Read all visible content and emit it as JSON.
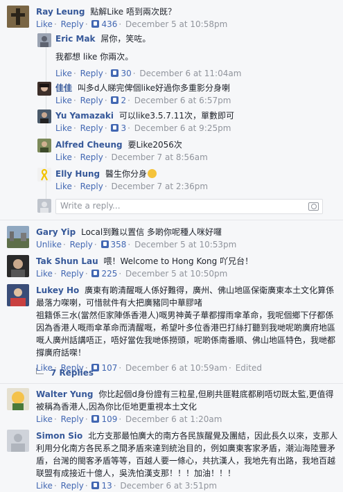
{
  "labels": {
    "like": "Like",
    "unlike": "Unlike",
    "reply": "Reply",
    "edited": "Edited",
    "sep": "·"
  },
  "comments": [
    {
      "name": "Ray Leung",
      "text": "點解Like 唔到兩次既？",
      "like_label": "Like",
      "likes": "436",
      "date": "December 5 at 10:58pm"
    },
    {
      "name": "Eric Mak",
      "text": "屌你，笑咗。",
      "text2": "我都想 like 你兩次。",
      "like_label": "Like",
      "likes": "30",
      "date": "December 6 at 11:04am"
    },
    {
      "name": "佳佳",
      "text": "叫多d人睇完俾個like好過你多重影分身喇",
      "like_label": "Like",
      "likes": "2",
      "date": "December 6 at 6:57pm"
    },
    {
      "name": "Yu Yamazaki",
      "text": "可以like3.5.7.11次，單數即可",
      "like_label": "Like",
      "likes": "3",
      "date": "December 6 at 9:25pm"
    },
    {
      "name": "Alfred Cheung",
      "text": "要Like2056次",
      "like_label": "Like",
      "date": "December 7 at 8:56am"
    },
    {
      "name": "Elly Hung",
      "text": "醫生你分身",
      "like_label": "Like",
      "date": "December 7 at 2:36pm"
    },
    {
      "name": "Gary Yip",
      "text": "Local到難以置信 多啲你呢種人咪好囉",
      "like_label": "Unlike",
      "likes": "358",
      "date": "December 5 at 10:53pm"
    },
    {
      "name": "Tak Shun Lau",
      "text": "喂！Welcome to Hong Kong 吖兄台！",
      "like_label": "Like",
      "likes": "225",
      "date": "December 5 at 10:50pm"
    },
    {
      "name": "Lukey Ho",
      "text": "廣東有啲清醒嘅人係好難得，廣州、佛山地區保衛廣東本土文化算係最落力㗎喇，可惜就件有大把廣豬同中華膠啫",
      "text2": "祖籍係三水(當然佢家陣係香港人)嘅男神黃子華都撐雨傘革命，我呢個鄉下仔都係因為香港人嘅雨傘革命而清醒嘅，希望叶多位香港巴打絲打聽到我哋呢啲廣府地區嘅人廣州話講唔正，唔好當佐我哋係撈頭，呢啲係南番順、佛山地區特色，我哋都撐廣府話㗎！",
      "like_label": "Like",
      "likes": "107",
      "date": "December 6 at 10:59am",
      "replies": "7 Replies"
    },
    {
      "name": "Walter Yung",
      "text": "你比起個d身份證有三粒星,但刷共匪鞋底都刷唔切既太監,更值得被稱為香港人,因為你比佢地更重視本土文化",
      "like_label": "Like",
      "likes": "109",
      "date": "December 6 at 1:20am"
    },
    {
      "name": "Simon Sio",
      "text": "北方支那最怕廣大的南方各民族醒覺及團結，因此長久以來，支那人利用分化南方各民系之間矛盾來達到統治目的，例如廣東客家矛盾，潮汕海陸豐矛盾，台灣的閩客矛盾等等，百越人要一條心，共抗漢人，我地先有出路，我地百越联盟有成接近十億人，吳洗怕漢支那！！！加油！！！",
      "like_label": "Like",
      "likes": "13",
      "date": "December 6 at 3:51pm"
    }
  ],
  "reply_input": {
    "placeholder": "Write a reply..."
  }
}
